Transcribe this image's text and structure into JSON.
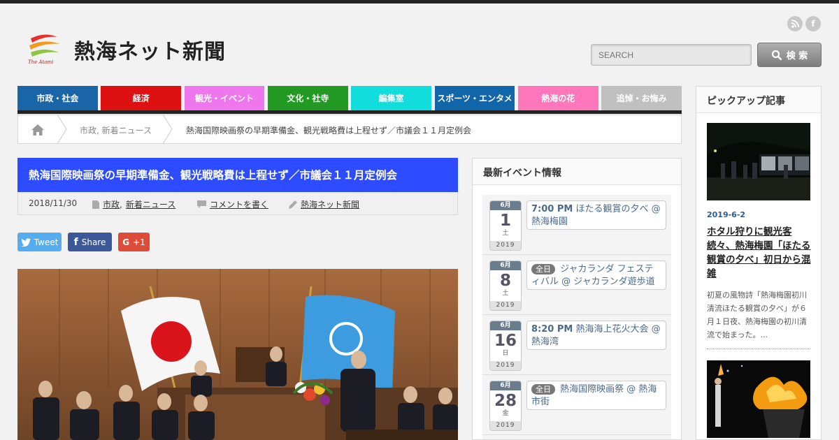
{
  "site": {
    "title": "熱海ネット新聞",
    "logo_text": "The Atami"
  },
  "header": {
    "social": [
      {
        "name": "rss-icon",
        "glyph": "◉"
      },
      {
        "name": "facebook-icon",
        "glyph": "f"
      }
    ],
    "search": {
      "placeholder": "SEARCH",
      "button_label": "検 索"
    }
  },
  "nav": {
    "items": [
      {
        "label": "市政・社会",
        "color": "#1a64a8"
      },
      {
        "label": "経済",
        "color": "#dd1111"
      },
      {
        "label": "観光・イベント",
        "color": "#ee77ee"
      },
      {
        "label": "文化・社寺",
        "color": "#229922"
      },
      {
        "label": "編集室",
        "color": "#11dddd"
      },
      {
        "label": "スポーツ・エンタメ",
        "color": "#1166aa"
      },
      {
        "label": "熱海の花",
        "color": "#ff77bb"
      },
      {
        "label": "追悼・お悔み",
        "color": "#c0c0c0"
      }
    ]
  },
  "breadcrumb": {
    "category": "市政, 新着ニュース",
    "current": "熱海国際映画祭の早期準備金、観光戦略費は上程せず／市議会１１月定例会"
  },
  "post": {
    "title": "熱海国際映画祭の早期準備金、観光戦略費は上程せず／市議会１１月定例会",
    "date": "2018/11/30",
    "categories": [
      "市政",
      "新着ニュース"
    ],
    "category_separator": ",",
    "comment_link": "コメントを書く",
    "author": "熱海ネット新聞",
    "share": {
      "tweet": "Tweet",
      "facebook": "Share",
      "gplus": "+1"
    }
  },
  "events": {
    "title": "最新イベント情報",
    "items": [
      {
        "month": "6月",
        "day": "1",
        "dow": "土",
        "year": "2019",
        "time": "7:00 PM",
        "all_day": false,
        "text": "ほたる観賞の夕べ @ 熱海梅園"
      },
      {
        "month": "6月",
        "day": "8",
        "dow": "土",
        "year": "2019",
        "time": "全日",
        "all_day": true,
        "text": "ジャカランダ フェスティバル @ ジャカランダ遊歩道"
      },
      {
        "month": "6月",
        "day": "16",
        "dow": "日",
        "year": "2019",
        "time": "8:20 PM",
        "all_day": false,
        "text": "熱海海上花火大会 @ 熱海湾"
      },
      {
        "month": "6月",
        "day": "28",
        "dow": "金",
        "year": "2019",
        "time": "全日",
        "all_day": true,
        "text": "熱海国際映画祭 @ 熱海市街"
      }
    ]
  },
  "pickup": {
    "title": "ピックアップ記事",
    "article": {
      "date": "2019-6-2",
      "title": "ホタル狩りに観光客続々、熱海梅園「ほたる観賞の夕べ」初日から混雑",
      "excerpt": "初夏の風物詩「熱海梅園初川清流ほたる観賞の夕べ」が６月１日夜、熱海梅園の初川清流で始まった。..."
    }
  }
}
